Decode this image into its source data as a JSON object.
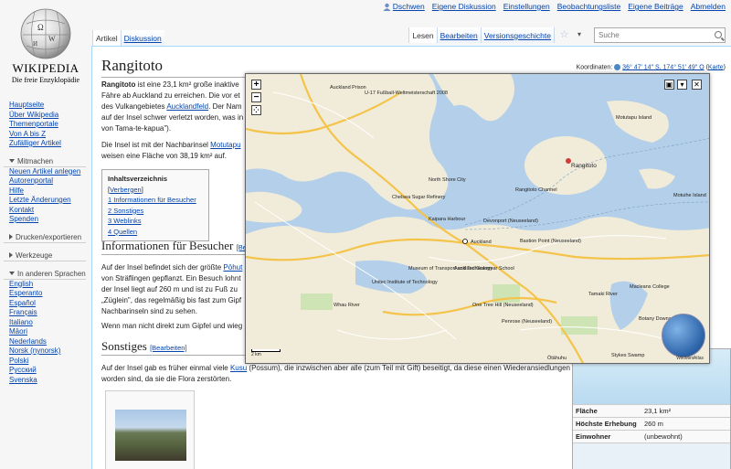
{
  "personal": [
    {
      "label": "Dschwen"
    },
    {
      "label": "Eigene Diskussion"
    },
    {
      "label": "Einstellungen"
    },
    {
      "label": "Beobachtungsliste"
    },
    {
      "label": "Eigene Beiträge"
    },
    {
      "label": "Abmelden"
    }
  ],
  "logo": {
    "wordmark": "WIKIPEDIA",
    "tagline": "Die freie Enzyklopädie"
  },
  "sidebar": {
    "nav": [
      "Hauptseite",
      "Über Wikipedia",
      "Themenportale",
      "Von A bis Z",
      "Zufälliger Artikel"
    ],
    "mitmachen_heading": "Mitmachen",
    "mitmachen": [
      "Neuen Artikel anlegen",
      "Autorenportal",
      "Hilfe",
      "Letzte Änderungen",
      "Kontakt",
      "Spenden"
    ],
    "drucken_heading": "Drucken/exportieren",
    "werkzeuge_heading": "Werkzeuge",
    "sprachen_heading": "In anderen Sprachen",
    "sprachen": [
      "English",
      "Esperanto",
      "Español",
      "Français",
      "Italiano",
      "Māori",
      "Nederlands",
      "Norsk (nynorsk)",
      "Polski",
      "Русский",
      "Svenska"
    ]
  },
  "tabs": {
    "artikel": "Artikel",
    "diskussion": "Diskussion",
    "lesen": "Lesen",
    "bearbeiten": "Bearbeiten",
    "versionsgeschichte": "Versionsgeschichte",
    "star": "☆",
    "more": "▾"
  },
  "search": {
    "placeholder": "Suche"
  },
  "article": {
    "title": "Rangitoto",
    "coords_label": "Koordinaten:",
    "coords_value": "36° 47′ 14″ S, 174° 51′ 49″ O",
    "coords_link": "Karte",
    "p1_bold": "Rangitoto",
    "p1_a": " ist eine 23,1 km² große inaktive",
    "p1_b": "Fähre ab Auckland zu erreichen. Die vor et",
    "p1_c": "des Vulkangebietes ",
    "p1_c_link": "Aucklandfeld",
    "p1_c2": ". Der Nam",
    "p1_d": "auf der Insel schwer verletzt worden, was in",
    "p1_e": "von Tama-te-kapua\").",
    "p2_a": "Die Insel ist mit der Nachbarinsel ",
    "p2_link": "Motutapu",
    "p2_b": "weisen eine Fläche von 38,19 km² auf.",
    "toc_title": "Inhaltsverzeichnis",
    "toc_toggle": "Verbergen",
    "toc": [
      "1 Informationen für Besucher",
      "2 Sonstiges",
      "3 Weblinks",
      "4 Quellen"
    ],
    "h2_besucher": "Informationen für Besucher",
    "h2_besucher_edit": "[Be",
    "b1": "Auf der Insel befindet sich der größte ",
    "b1_link": "Pōhut",
    "b2": "von Sträflingen gepflanzt. Ein Besuch lohnt",
    "b3": "der Insel liegt auf 260 m und ist zu Fuß zu",
    "b4": "„Züglein\", das regelmäßig bis fast zum Gipf",
    "b5": "Nachbarinseln sind zu sehen.",
    "b6": "Wenn man nicht direkt zum Gipfel und wieg",
    "h2_sonstiges": "Sonstiges",
    "edit_label": "[Bearbeiten]",
    "s1_a": "Auf der Insel gab es früher einmal viele ",
    "s1_link": "Kusu",
    "s1_b": " (Possum), die inzwischen aber alle (zum Teil mit Gift) beseitigt, da diese einen Wiederansiedlungen",
    "s2": "worden sind, da sie die Flora zerstörten."
  },
  "infobox": {
    "rows": [
      {
        "k": "Fläche",
        "v": "23,1 km²"
      },
      {
        "k": "Höchste Erhebung",
        "v": "260 m"
      },
      {
        "k": "Einwohner",
        "v": "(unbewohnt)"
      }
    ]
  },
  "map": {
    "labels": {
      "prison": "Auckland Prison",
      "hospital": "U-17 Fußball-Weltmeisterschaft 2008",
      "motutapu": "Motutapu Island",
      "rangitoto": "Rangitoto",
      "northshore": "North Shore City",
      "chelsea": "Chelsea Sugar Refinery",
      "channel": "Rangitoto Channel",
      "motuihe": "Motuihe Island",
      "harbour": "Kaipara Harbour",
      "devonport": "Devonport (Neuseeland)",
      "auckland": "Auckland",
      "bastion": "Bastion Point (Neuseeland)",
      "mat": "Museum of Transport and Technology",
      "grammar": "Auckland Grammar School",
      "unitec": "Unitec Institute of Technology",
      "whau": "Whau River",
      "onetree": "One Tree Hill (Neuseeland)",
      "tamaki": "Tamaki River",
      "macleans": "Macleans College",
      "botany": "Botany Downs",
      "penrose": "Penrose (Neuseeland)",
      "otahuhu": "Ōtāhuhu",
      "stykes": "Stykes Swamp",
      "scale": "2 km",
      "attrib": "WikiMiniAtlas"
    },
    "controls": {
      "zoom_in": "+",
      "zoom_out": "−",
      "reset": "⁘",
      "expand": "▣",
      "menu": "▾",
      "close": "✕"
    }
  }
}
